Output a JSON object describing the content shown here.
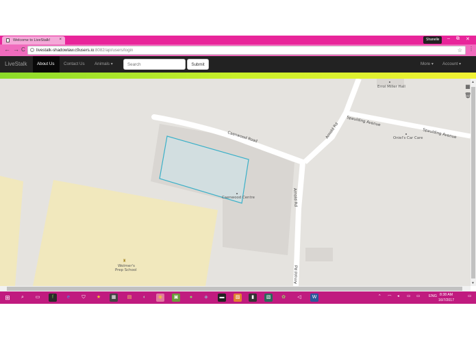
{
  "browser": {
    "tab_title": "Welcome to LiveStalk!",
    "tab_close": "×",
    "user_name": "Shanelle",
    "window_controls": [
      "–",
      "⧉",
      "✕"
    ],
    "nav_buttons": [
      "←",
      "→",
      "C"
    ],
    "url_host": "livestalk-shadowlaw.c9users.io",
    "url_path": ":8082/api/users/login",
    "info_icon": "info-icon",
    "star_icon": "star-icon",
    "menu_icon": "menu-dots-icon"
  },
  "navbar": {
    "brand": "LiveStalk",
    "links": [
      "About Us",
      "Contact Us",
      "Animals ▾"
    ],
    "search_placeholder": "Search",
    "submit_label": "Submit",
    "right_links": [
      "More ▾",
      "Account ▾"
    ]
  },
  "map": {
    "labels": {
      "caenwood_road": "Caenwood Road",
      "arnold_rd_top": "Arnold Rd",
      "arnold_rd_mid": "Arnold Rd",
      "arnold_rd_bottom": "Arnold Rd",
      "spaulding_ave_1": "Spaulding Avenue",
      "spaulding_ave_2": "Spaulding Avenue",
      "errol_miller_hall": "Errol Miller Hall",
      "oniels_car_care": "Oniel's Car Care",
      "caenwood_centre": "Caenwood Centre",
      "wolmers_line1": "Wolmer's",
      "wolmers_line2": "Prep School"
    },
    "colors": {
      "background": "#e5e3df",
      "road": "#ffffff",
      "building_lot": "#d9d6d2",
      "school_area": "#f1e8bd",
      "polygon_stroke": "#3ab0c8",
      "polygon_fill": "#cfe0e4"
    }
  },
  "taskbar": {
    "start_icon": "windows-start-icon",
    "icons": [
      "search-icon",
      "task-view-icon",
      "app-f-icon",
      "edge-icon",
      "store-icon",
      "star-app-icon",
      "calculator-icon",
      "app-icon",
      "chrome-icon",
      "app-icon",
      "app-icon",
      "files-icon",
      "terminal-icon",
      "app-icon",
      "app-icon",
      "app-icon",
      "app-icon",
      "app-icon",
      "word-icon"
    ],
    "tray_lang": "ENG",
    "time": "8:38 AM",
    "date": "16/7/2017"
  }
}
